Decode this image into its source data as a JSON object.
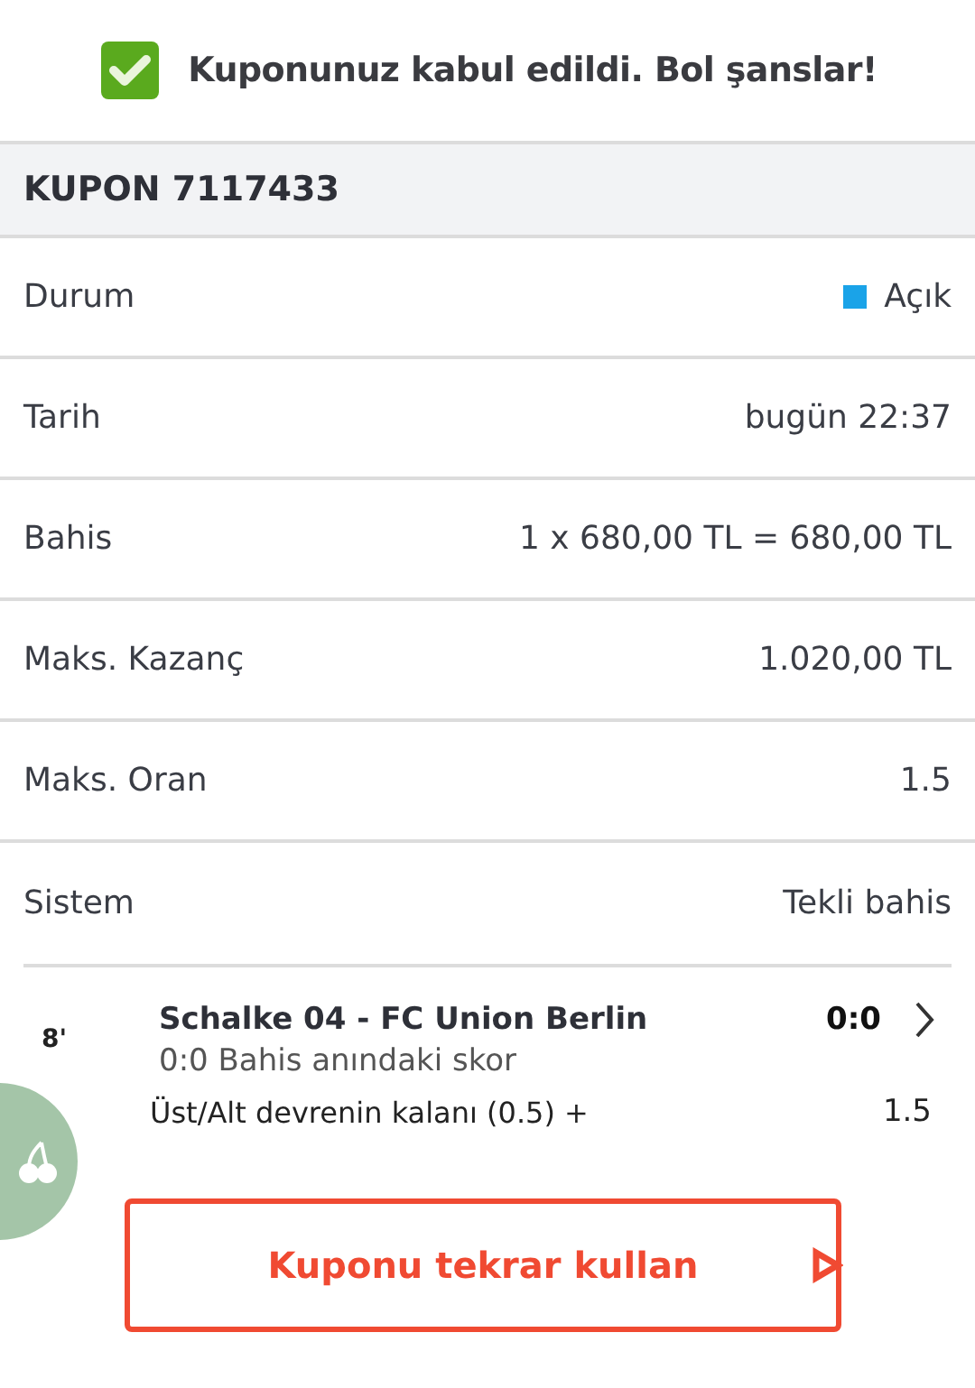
{
  "notice": {
    "text": "Kuponunuz kabul edildi. Bol şanslar!"
  },
  "coupon": {
    "title": "KUPON 7117433"
  },
  "details": [
    {
      "label": "Durum",
      "value": "Açık",
      "color": "#1aa3e8"
    },
    {
      "label": "Tarih",
      "value": "bugün 22:37"
    },
    {
      "label": "Bahis",
      "value": "1 x 680,00 TL = 680,00 TL"
    },
    {
      "label": "Maks. Kazanç",
      "value": "1.020,00 TL"
    },
    {
      "label": "Maks. Oran",
      "value": "1.5"
    },
    {
      "label": "Sistem",
      "value": "Tekli bahis"
    }
  ],
  "match": {
    "minute": "8'",
    "teams": "Schalke 04 - FC Union Berlin",
    "score": "0:0",
    "score_note": "0:0 Bahis anındaki skor",
    "market": "Üst/Alt devrenin kalanı (0.5) +",
    "odds": "1.5"
  },
  "reuse_button": {
    "label": "Kuponu tekrar kullan"
  }
}
